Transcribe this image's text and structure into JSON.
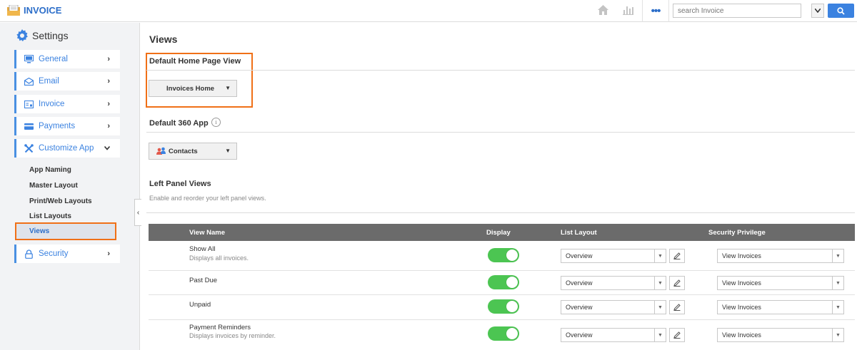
{
  "app": {
    "title": "INVOICE"
  },
  "topbar": {
    "home_icon": "home-icon",
    "chart_icon": "chart-icon",
    "more_label": "•••",
    "search_placeholder": "search Invoice"
  },
  "sidebar": {
    "heading": "Settings",
    "items": [
      {
        "label": "General",
        "icon": "monitor-icon"
      },
      {
        "label": "Email",
        "icon": "envelope-icon"
      },
      {
        "label": "Invoice",
        "icon": "invoice-icon"
      },
      {
        "label": "Payments",
        "icon": "card-icon"
      },
      {
        "label": "Customize App",
        "icon": "tools-icon"
      },
      {
        "label": "Security",
        "icon": "lock-icon"
      }
    ],
    "sub_items": [
      "App Naming",
      "Master Layout",
      "Print/Web Layouts",
      "List Layouts",
      "Views"
    ]
  },
  "main": {
    "title": "Views",
    "default_home": {
      "heading": "Default Home Page View",
      "value": "Invoices Home"
    },
    "default_360": {
      "heading": "Default 360 App",
      "value": "Contacts"
    },
    "left_panel": {
      "heading": "Left Panel Views",
      "description": "Enable and reorder your left panel views."
    },
    "table": {
      "columns": [
        "View Name",
        "Display",
        "List Layout",
        "Security Privilege"
      ],
      "rows": [
        {
          "name": "Show All",
          "desc": "Displays all invoices.",
          "display": true,
          "layout": "Overview",
          "privilege": "View Invoices"
        },
        {
          "name": "Past Due",
          "desc": "",
          "display": true,
          "layout": "Overview",
          "privilege": "View Invoices"
        },
        {
          "name": "Unpaid",
          "desc": "",
          "display": true,
          "layout": "Overview",
          "privilege": "View Invoices"
        },
        {
          "name": "Payment Reminders",
          "desc": "Displays invoices by reminder.",
          "display": true,
          "layout": "Overview",
          "privilege": "View Invoices"
        }
      ]
    }
  },
  "colors": {
    "accent": "#3b82e0",
    "highlight": "#f07017",
    "toggle_on": "#4cc552"
  }
}
